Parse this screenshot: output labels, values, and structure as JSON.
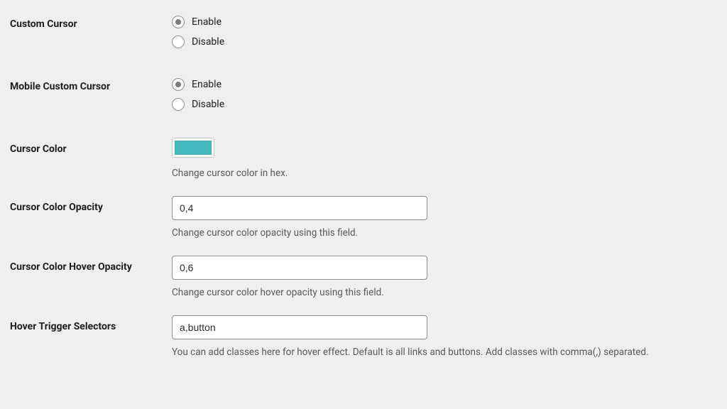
{
  "rows": {
    "customCursor": {
      "label": "Custom Cursor",
      "enable": "Enable",
      "disable": "Disable",
      "selected": "enable"
    },
    "mobileCustomCursor": {
      "label": "Mobile Custom Cursor",
      "enable": "Enable",
      "disable": "Disable",
      "selected": "enable"
    },
    "cursorColor": {
      "label": "Cursor Color",
      "hex": "#44b8c0",
      "desc": "Change cursor color in hex."
    },
    "cursorColorOpacity": {
      "label": "Cursor Color Opacity",
      "value": "0,4",
      "desc": "Change cursor color opacity using this field."
    },
    "cursorColorHoverOpacity": {
      "label": "Cursor Color Hover Opacity",
      "value": "0,6",
      "desc": "Change cursor color hover opacity using this field."
    },
    "hoverTriggerSelectors": {
      "label": "Hover Trigger Selectors",
      "value": "a,button",
      "desc": "You can add classes here for hover effect. Default is all links and buttons. Add classes with comma(,) separated."
    }
  }
}
